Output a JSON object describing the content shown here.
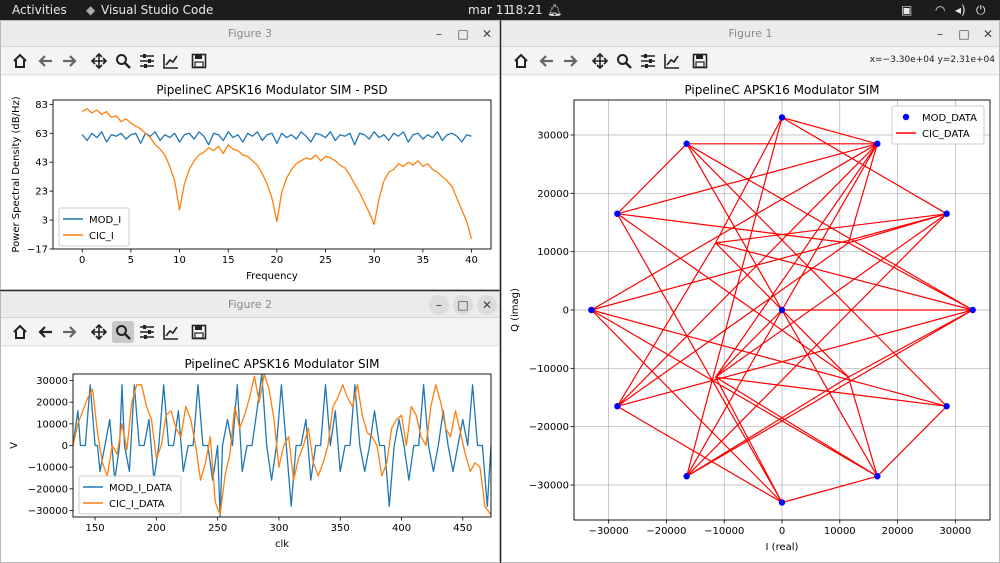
{
  "system": {
    "activities": "Activities",
    "app": "Visual Studio Code",
    "date": "mar 11",
    "time": "18:21"
  },
  "fig3": {
    "window_title": "Figure 3",
    "chart_data": {
      "type": "line",
      "title": "PipelineC APSK16 Modulator SIM - PSD",
      "xlabel": "Frequency",
      "ylabel": "Power Spectral Density (dB/Hz)",
      "xlim": [
        -3,
        42
      ],
      "ylim": [
        -17,
        86
      ],
      "xticks": [
        0,
        5,
        10,
        15,
        20,
        25,
        30,
        35,
        40
      ],
      "yticks": [
        -17,
        3,
        23,
        43,
        63,
        83
      ],
      "legend": "lower-left",
      "series": [
        {
          "name": "MOD_I",
          "color": "#1f77b4",
          "x": [
            0,
            0.5,
            1,
            1.5,
            2,
            2.5,
            3,
            3.5,
            4,
            4.5,
            5,
            5.5,
            6,
            6.5,
            7,
            7.5,
            8,
            8.5,
            9,
            9.5,
            10,
            10.5,
            11,
            11.5,
            12,
            12.5,
            13,
            13.5,
            14,
            14.5,
            15,
            15.5,
            16,
            16.5,
            17,
            17.5,
            18,
            18.5,
            19,
            19.5,
            20,
            20.5,
            21,
            21.5,
            22,
            22.5,
            23,
            23.5,
            24,
            24.5,
            25,
            25.5,
            26,
            26.5,
            27,
            27.5,
            28,
            28.5,
            29,
            29.5,
            30,
            30.5,
            31,
            31.5,
            32,
            32.5,
            33,
            33.5,
            34,
            34.5,
            35,
            35.5,
            36,
            36.5,
            37,
            37.5,
            38,
            38.5,
            39,
            39.5,
            40
          ],
          "y": [
            62,
            58,
            63,
            60,
            64,
            57,
            62,
            61,
            63,
            59,
            62,
            63,
            56,
            63,
            61,
            64,
            58,
            62,
            60,
            63,
            57,
            62,
            63,
            59,
            64,
            61,
            55,
            63,
            62,
            58,
            64,
            60,
            62,
            57,
            63,
            61,
            64,
            58,
            62,
            63,
            56,
            63,
            60,
            62,
            59,
            64,
            61,
            57,
            63,
            62,
            60,
            64,
            58,
            62,
            61,
            63,
            55,
            63,
            62,
            59,
            64,
            60,
            62,
            58,
            63,
            61,
            64,
            57,
            62,
            63,
            59,
            62,
            60,
            64,
            58,
            62,
            63,
            61,
            57,
            62,
            61
          ]
        },
        {
          "name": "CIC_I",
          "color": "#ff7f0e",
          "x": [
            0,
            0.5,
            1,
            1.5,
            2,
            2.5,
            3,
            3.5,
            4,
            4.5,
            5,
            5.5,
            6,
            6.5,
            7,
            7.5,
            8,
            8.5,
            9,
            9.5,
            10,
            10.5,
            11,
            11.5,
            12,
            12.5,
            13,
            13.5,
            14,
            14.5,
            15,
            15.5,
            16,
            16.5,
            17,
            17.5,
            18,
            18.5,
            19,
            19.5,
            20,
            20.5,
            21,
            21.5,
            22,
            22.5,
            23,
            23.5,
            24,
            24.5,
            25,
            25.5,
            26,
            26.5,
            27,
            27.5,
            28,
            28.5,
            29,
            29.5,
            30,
            30.5,
            31,
            31.5,
            32,
            32.5,
            33,
            33.5,
            34,
            34.5,
            35,
            35.5,
            36,
            36.5,
            37,
            37.5,
            38,
            38.5,
            39,
            39.5,
            40
          ],
          "y": [
            78,
            80,
            77,
            79,
            76,
            78,
            74,
            75,
            71,
            73,
            70,
            68,
            66,
            63,
            60,
            55,
            52,
            48,
            40,
            30,
            10,
            28,
            38,
            44,
            48,
            50,
            53,
            51,
            54,
            49,
            55,
            52,
            51,
            48,
            47,
            44,
            41,
            35,
            28,
            18,
            2,
            22,
            32,
            38,
            42,
            44,
            46,
            45,
            48,
            44,
            47,
            46,
            44,
            41,
            39,
            34,
            28,
            22,
            15,
            8,
            0,
            18,
            30,
            36,
            38,
            42,
            40,
            43,
            41,
            44,
            40,
            42,
            38,
            36,
            33,
            30,
            26,
            18,
            10,
            2,
            -10
          ]
        }
      ]
    }
  },
  "fig2": {
    "window_title": "Figure 2",
    "chart_data": {
      "type": "line",
      "title": "PipelineC APSK16 Modulator SIM",
      "xlabel": "clk",
      "ylabel": "V",
      "xlim": [
        132,
        473
      ],
      "ylim": [
        -33000,
        33000
      ],
      "xticks": [
        150,
        200,
        250,
        300,
        350,
        400,
        450
      ],
      "yticks": [
        -30000,
        -20000,
        -10000,
        0,
        10000,
        20000,
        30000
      ],
      "legend": "lower-left",
      "series": [
        {
          "name": "MOD_I_DATA",
          "color": "#1f77b4",
          "x": [
            132,
            136,
            138,
            142,
            146,
            150,
            152,
            154,
            158,
            162,
            166,
            170,
            172,
            174,
            178,
            182,
            186,
            190,
            194,
            198,
            202,
            206,
            210,
            214,
            218,
            222,
            226,
            230,
            234,
            238,
            242,
            246,
            250,
            252,
            254,
            258,
            262,
            266,
            270,
            274,
            278,
            282,
            286,
            290,
            294,
            298,
            302,
            306,
            310,
            314,
            318,
            322,
            326,
            330,
            334,
            338,
            342,
            346,
            350,
            354,
            358,
            362,
            366,
            370,
            374,
            378,
            382,
            386,
            390,
            394,
            398,
            402,
            406,
            410,
            414,
            418,
            422,
            426,
            430,
            434,
            438,
            442,
            446,
            450,
            454,
            458,
            462,
            466,
            470,
            473
          ],
          "y": [
            0,
            16000,
            0,
            0,
            28000,
            0,
            0,
            -12000,
            0,
            12000,
            -16000,
            0,
            28000,
            0,
            -12000,
            28000,
            0,
            0,
            12000,
            -16000,
            0,
            28000,
            0,
            0,
            16000,
            -12000,
            0,
            0,
            28000,
            0,
            0,
            -16000,
            0,
            -33000,
            0,
            12000,
            0,
            28000,
            -12000,
            0,
            0,
            16000,
            33000,
            0,
            -16000,
            0,
            28000,
            0,
            -28000,
            0,
            0,
            12000,
            -16000,
            0,
            0,
            28000,
            0,
            16000,
            -12000,
            0,
            0,
            28000,
            0,
            -12000,
            0,
            16000,
            0,
            0,
            -28000,
            0,
            12000,
            0,
            -16000,
            0,
            0,
            28000,
            0,
            -12000,
            0,
            16000,
            0,
            -12000,
            0,
            12000,
            0,
            28000,
            0,
            0,
            -28000,
            0
          ]
        },
        {
          "name": "CIC_I_DATA",
          "color": "#ff7f0e",
          "x": [
            132,
            136,
            140,
            144,
            148,
            152,
            156,
            160,
            164,
            168,
            172,
            176,
            180,
            184,
            188,
            192,
            196,
            200,
            204,
            208,
            212,
            216,
            220,
            224,
            228,
            232,
            236,
            240,
            244,
            248,
            252,
            256,
            260,
            264,
            268,
            272,
            276,
            280,
            284,
            288,
            292,
            296,
            300,
            304,
            308,
            312,
            316,
            320,
            324,
            328,
            332,
            336,
            340,
            344,
            348,
            352,
            356,
            360,
            364,
            368,
            372,
            376,
            380,
            384,
            388,
            392,
            396,
            400,
            404,
            408,
            412,
            416,
            420,
            424,
            428,
            432,
            436,
            440,
            444,
            448,
            452,
            456,
            460,
            464,
            468,
            473
          ],
          "y": [
            0,
            10000,
            16000,
            22000,
            26000,
            6000,
            -8000,
            -14000,
            0,
            -4000,
            10000,
            -2000,
            20000,
            28000,
            28000,
            18000,
            12000,
            -6000,
            0,
            14000,
            16000,
            8000,
            4000,
            18000,
            12000,
            0,
            -16000,
            -8000,
            4000,
            -26000,
            -32000,
            -14000,
            -4000,
            18000,
            8000,
            14000,
            22000,
            32000,
            20000,
            33000,
            26000,
            12000,
            -10000,
            0,
            4000,
            -16000,
            -6000,
            0,
            8000,
            -8000,
            -14000,
            -8000,
            0,
            18000,
            22000,
            28000,
            22000,
            18000,
            28000,
            14000,
            6000,
            4000,
            0,
            -14000,
            -8000,
            8000,
            12000,
            14000,
            0,
            18000,
            14000,
            4000,
            0,
            18000,
            28000,
            20000,
            8000,
            4000,
            16000,
            6000,
            -4000,
            -12000,
            -8000,
            -10000,
            -28000,
            -32000
          ]
        }
      ]
    }
  },
  "fig1": {
    "window_title": "Figure 1",
    "coords": "x=−3.30e+04 y=2.31e+04",
    "chart_data": {
      "type": "scatter",
      "title": "PipelineC APSK16 Modulator SIM",
      "xlabel": "I (real)",
      "ylabel": "Q (imag)",
      "xlim": [
        -36000,
        36000
      ],
      "ylim": [
        -36000,
        36000
      ],
      "xticks": [
        -30000,
        -20000,
        -10000,
        0,
        10000,
        20000,
        30000
      ],
      "yticks": [
        -30000,
        -20000,
        -10000,
        0,
        10000,
        20000,
        30000
      ],
      "grid": true,
      "legend": "top-right",
      "series": [
        {
          "name": "MOD_DATA",
          "color": "#0000ff",
          "x": [
            0,
            16500,
            28500,
            33000,
            28500,
            16500,
            0,
            -16500,
            -28500,
            -33000,
            -28500,
            -16500,
            0
          ],
          "y": [
            33000,
            28500,
            16500,
            0,
            -16500,
            -28500,
            -33000,
            -28500,
            -16500,
            0,
            16500,
            28500,
            0
          ]
        },
        {
          "name": "CIC_DATA",
          "color": "#ff0000",
          "x": [
            0,
            16500,
            -28500,
            33000,
            -16500,
            11500,
            -11500,
            28500,
            -33000,
            16500,
            0,
            -28500,
            11500,
            16500,
            -16500,
            28500,
            -11500,
            0,
            33000,
            -28500,
            -11500,
            11500,
            16500,
            -33000,
            28500,
            0,
            -16500,
            33000,
            11500,
            -28500,
            16500,
            -11500,
            0,
            -33000,
            28500,
            16500,
            -16500,
            -28500,
            11500,
            33000,
            -11500,
            0,
            28500,
            -16500,
            16500,
            -33000,
            0,
            -28500,
            11500,
            28500,
            -11500,
            16500,
            0,
            -16500,
            33000
          ],
          "y": [
            33000,
            28500,
            -16500,
            0,
            -28500,
            -11500,
            11500,
            16500,
            0,
            -28500,
            -33000,
            16500,
            11500,
            28500,
            28500,
            -16500,
            -11500,
            0,
            0,
            -16500,
            11500,
            -11500,
            -28500,
            0,
            16500,
            33000,
            -28500,
            0,
            11500,
            16500,
            28500,
            -11500,
            -33000,
            0,
            -16500,
            -28500,
            28500,
            16500,
            -11500,
            0,
            11500,
            33000,
            16500,
            -28500,
            28500,
            0,
            -33000,
            -16500,
            11500,
            16500,
            -11500,
            -28500,
            0,
            28500,
            0
          ]
        }
      ]
    }
  }
}
